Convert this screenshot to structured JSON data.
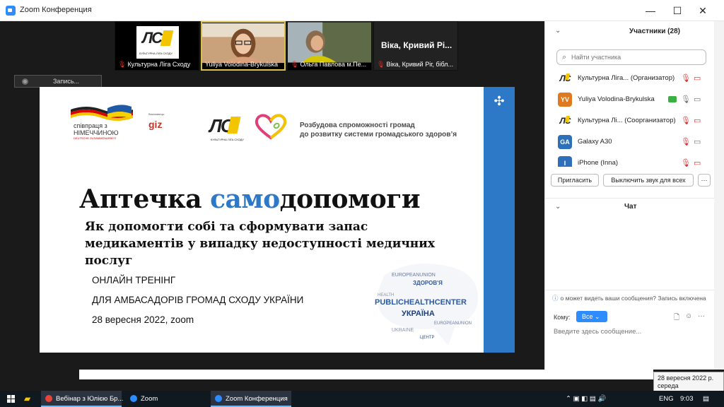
{
  "window": {
    "title": "Zoom Конференция",
    "minimize": "—",
    "maximize": "☐",
    "close": "✕"
  },
  "thumbnails": [
    {
      "name": "Культурна Ліга Сходу",
      "logo_text": "ЛС",
      "logo_sub": "КУЛЬТУРНА ЛІГА СХОДУ"
    },
    {
      "name": "Yuliya Volodina-Brykulska"
    },
    {
      "name": "Ольга Павлова м.Пе..."
    },
    {
      "name": "Віка, Кривий Ріг, бібл...",
      "center_name": "Віка, Кривий Рі..."
    }
  ],
  "next_icon": "›",
  "recording": {
    "label": "Запись..."
  },
  "slide": {
    "partner1_line1": "співпраця з",
    "partner1_line2": "НІМЕЧЧИНОЮ",
    "partner1_sub": "DEUTSCHE ZUSAMMENARBEIT",
    "giz_small": "Виконавець:",
    "giz": "giz",
    "ulc_mark": "ЛС",
    "ulc_sub": "КУЛЬТУРНА ЛІГА СХОДУ",
    "project_line1": "Розбудова спроможності громад",
    "project_line2": "до розвитку системи громадського здоров’я",
    "title_before": "Аптечка ",
    "title_accent": "само",
    "title_after": "допомоги",
    "subtitle": "Як допомогти собі та сформувати запас медикаментів у випадку недоступності медичних послуг",
    "training_line1": "ОНЛАЙН ТРЕНІНГ",
    "training_line2": "ДЛЯ АМБАСАДОРІВ ГРОМАД СХОДУ УКРАЇНИ",
    "training_line3": "28 вересня 2022, zoom",
    "wordcloud": [
      "PUBLICHEALTHCENTER",
      "УКРАЇНА",
      "ЗДОРОВ'Я",
      "EUROPEANUNION",
      "HEALTH",
      "UKRAINE",
      "ЦЕНТР"
    ]
  },
  "participants": {
    "title": "Участники (28)",
    "search_placeholder": "Найти участника",
    "rows": [
      {
        "avatar": "ЛС",
        "name": "Культурна Ліга...  (Организатор)"
      },
      {
        "avatar": "YV",
        "name": "Yuliya Volodina-Brykulska"
      },
      {
        "avatar": "ЛС",
        "name": "Культурна Лі...  (Соорганизатор)"
      },
      {
        "avatar": "GA",
        "name": "Galaxy A30"
      },
      {
        "avatar": "I",
        "name": "iPhone (Inna)"
      }
    ],
    "invite": "Пригласить",
    "mute_all": "Выключить звук для всех",
    "more": "···"
  },
  "chat": {
    "title": "Чат",
    "note": "о может видеть ваши сообщения? Запись включена",
    "to_label": "Кому:",
    "to_value": "Все",
    "input_placeholder": "Введите здесь сообщение..."
  },
  "taskbar": {
    "items": [
      "Вебінар з Юлією Бр...",
      "Zoom",
      "Zoom Конференция"
    ],
    "lang": "ENG",
    "time": "9:03"
  },
  "tooltip": {
    "line1": "28 вересня 2022 р.",
    "line2": "середа"
  },
  "colors": {
    "zoom_blue": "#2d8cff",
    "slide_blue": "#2e78c8",
    "muted_red": "#e02d2d"
  }
}
